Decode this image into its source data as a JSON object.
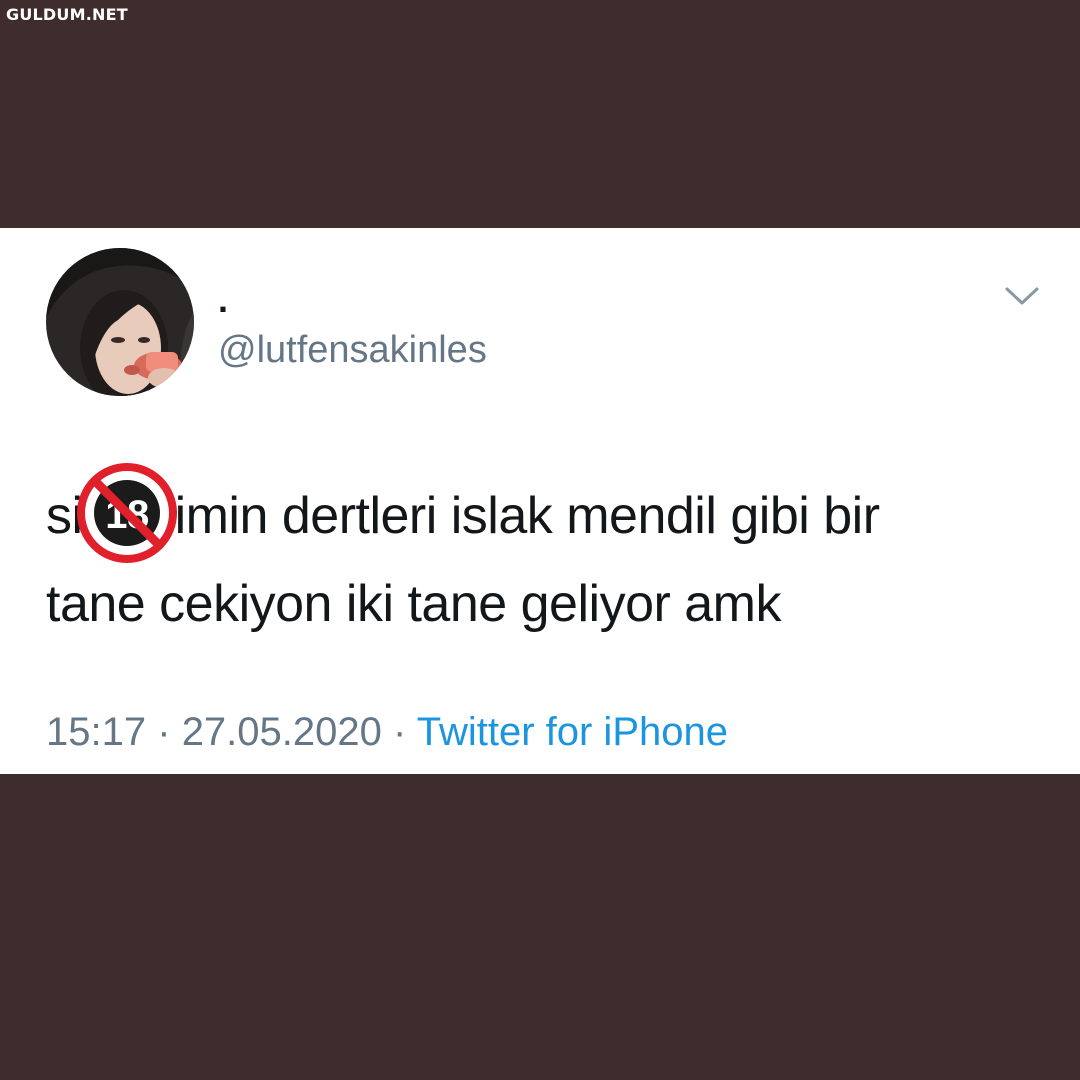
{
  "watermark": "GULDUM.NET",
  "tweet": {
    "display_name": ".",
    "handle": "@lutfensakinles",
    "text_line1_before": "si",
    "text_line1_after": "imin dertleri islak mendil gibi bir",
    "text_line2": "tane cekiyon iki tane geliyor amk",
    "censor_badge_text": "18",
    "time": "15:17",
    "separator": "·",
    "date": "27.05.2020",
    "source": "Twitter for iPhone"
  },
  "icons": {
    "menu": "chevron-down-icon",
    "censor": "no-under-eighteen-icon"
  },
  "colors": {
    "frame_background": "#3f2c2c",
    "card_background": "#ffffff",
    "text_primary": "#14171a",
    "text_secondary": "#657786",
    "link": "#1b95e0",
    "censor_red": "#e0202a"
  }
}
